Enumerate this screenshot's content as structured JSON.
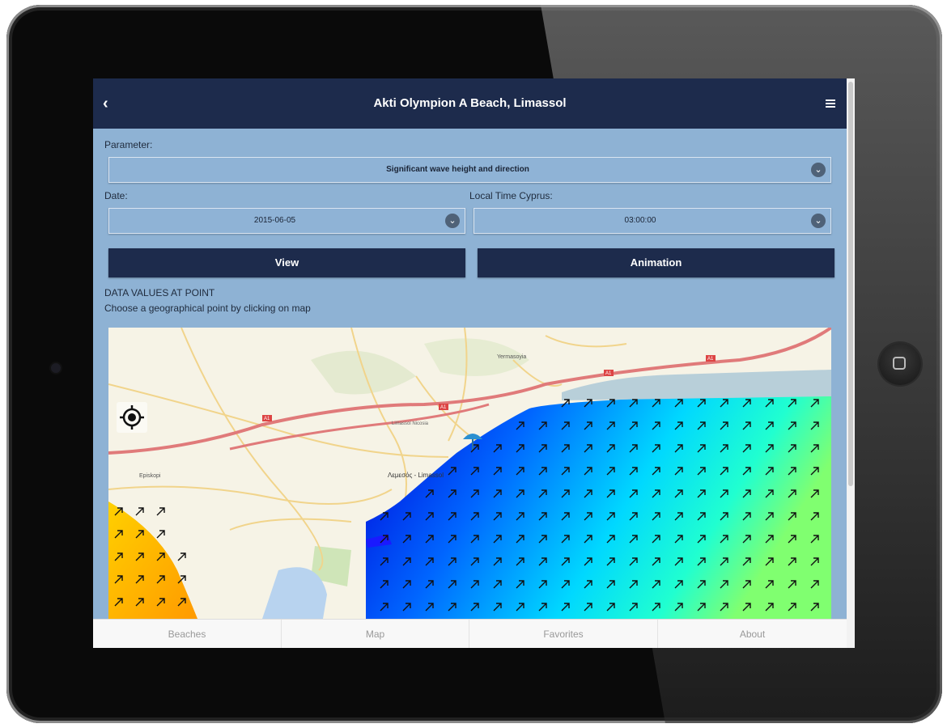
{
  "header": {
    "title": "Akti Olympion A Beach, Limassol"
  },
  "form": {
    "parameter_label": "Parameter:",
    "parameter_value": "Significant wave height and direction",
    "date_label": "Date:",
    "date_value": "2015-06-05",
    "time_label": "Local Time Cyprus:",
    "time_value": "03:00:00"
  },
  "buttons": {
    "view": "View",
    "animation": "Animation"
  },
  "info": {
    "heading": "DATA VALUES AT POINT",
    "hint": "Choose a geographical point by clicking on map"
  },
  "map": {
    "places": [
      "Yermasoyia",
      "Episkopi",
      "Λεμεσός - Limassol",
      "Limassol Nicosia"
    ],
    "road_labels": [
      "A1",
      "A1",
      "A1",
      "A1"
    ],
    "icons": [
      "back-icon",
      "menu-icon",
      "chevron-down-icon",
      "locate-icon",
      "beach-umbrella-icon",
      "wave-direction-arrow-icon"
    ],
    "colors": {
      "land": "#f6f3e6",
      "road": "#e07a7a",
      "wave_low": "#0000e0",
      "wave_mid": "#00e8ff",
      "wave_high": "#ffb000"
    }
  },
  "tabs": [
    "Beaches",
    "Map",
    "Favorites",
    "About"
  ]
}
